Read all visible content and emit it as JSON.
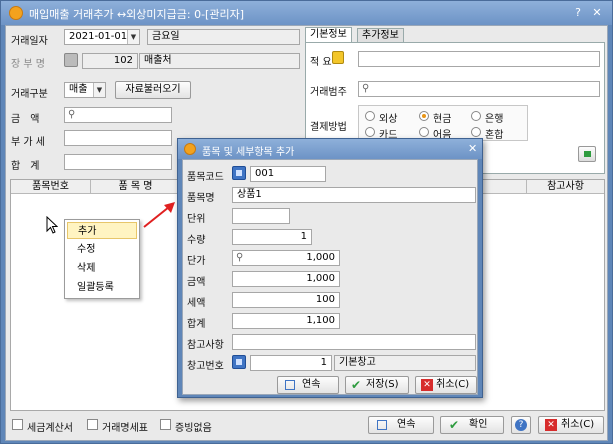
{
  "window": {
    "title": "매입매출 거래추가 ↔외상미지급금: 0-[관리자]",
    "help_btn": "?",
    "close_btn": "✕"
  },
  "form": {
    "trade_date_label": "거래일자",
    "trade_date": "2021-01-01",
    "weekday": "금요일",
    "ledger_label": "장 부 명",
    "ledger_code": "102",
    "ledger_name": "매출처",
    "trade_type_label": "거래구분",
    "trade_type": "매출",
    "load_button": "자료불러오기",
    "amount_label": "금　액",
    "vat_label": "부 가 세",
    "total_label": "합　계"
  },
  "tabs": [
    {
      "label": "기본정보"
    },
    {
      "label": "추가정보"
    }
  ],
  "basic": {
    "memo_label": "적 요",
    "category_label": "거래범주",
    "payment_label": "결제방법",
    "payment_options": [
      "외상",
      "현금",
      "은행",
      "카드",
      "어음",
      "혼합"
    ],
    "payment_selected": "현금"
  },
  "grid": {
    "columns": [
      "품목번호",
      "품 목 명",
      "참고사항"
    ]
  },
  "context_menu": {
    "items": [
      "추가",
      "수정",
      "삭제",
      "일괄등록"
    ],
    "highlighted": "추가"
  },
  "dialog": {
    "title": "품목 및 세부항목 추가",
    "fields": {
      "item_code_label": "품목코드",
      "item_code": "001",
      "item_name_label": "품목명",
      "item_name": "상품1",
      "unit_label": "단위",
      "unit": "",
      "qty_label": "수량",
      "qty": "1",
      "price_label": "단가",
      "price": "1,000",
      "amount_label": "금액",
      "amount": "1,000",
      "tax_label": "세액",
      "tax": "100",
      "total_label": "합계",
      "total": "1,100",
      "note_label": "참고사항",
      "note": "",
      "warehouse_label": "창고번호",
      "warehouse_no": "1",
      "warehouse_name": "기본창고"
    },
    "buttons": {
      "continue": "연속",
      "save": "저장(S)",
      "cancel": "취소(C)"
    }
  },
  "bottom": {
    "checks": [
      "세금계산서",
      "거래명세표",
      "증빙없음"
    ],
    "continue": "연속",
    "ok": "확인",
    "cancel": "취소(C)"
  },
  "colors": {
    "title_bar": "#7399cc",
    "accent_orange": "#f3a21d",
    "arrow_red": "#e02020"
  }
}
